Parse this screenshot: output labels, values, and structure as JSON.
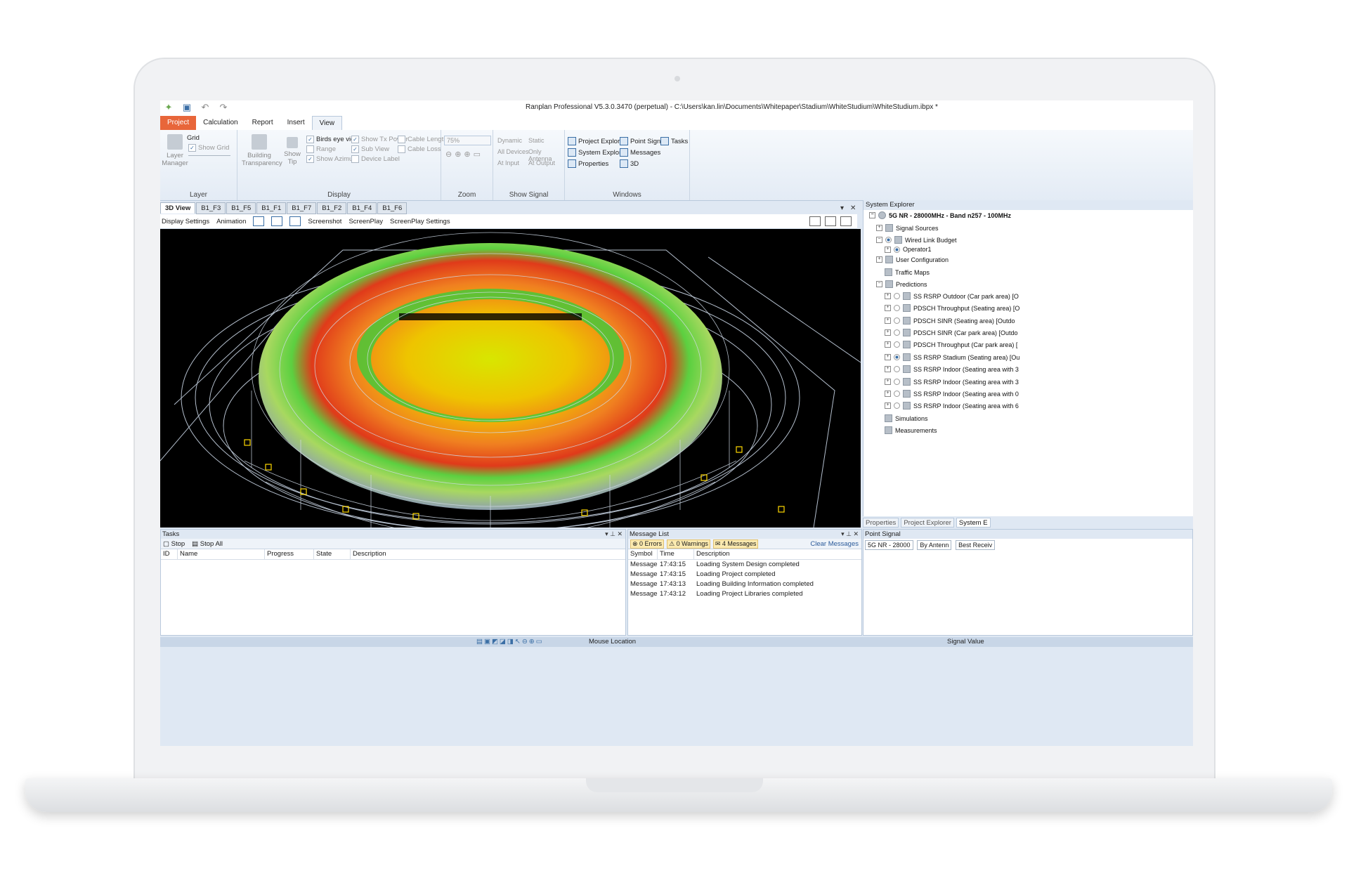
{
  "app": {
    "title": "Ranplan Professional V5.3.0.3470 (perpetual) - C:\\Users\\kan.lin\\Documents\\Whitepaper\\Stadium\\WhiteStudium\\WhiteStudium.ibpx *"
  },
  "ribbon_tabs": [
    "Project",
    "Calculation",
    "Report",
    "Insert",
    "View"
  ],
  "ribbon": {
    "layer": {
      "label": "Layer",
      "layer_manager": "Layer Manager",
      "grid": "Grid",
      "show_grid": "Show Grid"
    },
    "display": {
      "label": "Display",
      "building_transparency": "Building Transparency",
      "show_tip": "Show Tip",
      "options": [
        {
          "label": "Birds eye view",
          "checked": true
        },
        {
          "label": "Show Tx Power",
          "checked": true
        },
        {
          "label": "Cable Length",
          "checked": false
        },
        {
          "label": "Range",
          "checked": false
        },
        {
          "label": "Sub View",
          "checked": true
        },
        {
          "label": "Cable Loss",
          "checked": false
        },
        {
          "label": "Show Azimuth",
          "checked": true
        },
        {
          "label": "Device Label",
          "checked": false
        }
      ]
    },
    "zoom": {
      "label": "Zoom",
      "value": "75%"
    },
    "show_signal": {
      "label": "Show Signal",
      "items": [
        "Dynamic",
        "Static",
        "All Devices",
        "Only Antenna",
        "At Input",
        "At Output"
      ]
    },
    "windows": {
      "label": "Windows",
      "items": [
        "Project Explorer",
        "Point Signal",
        "Tasks",
        "System Explorer",
        "Messages",
        "Properties",
        "3D"
      ]
    }
  },
  "doc_tabs": [
    "3D View",
    "B1_F3",
    "B1_F5",
    "B1_F1",
    "B1_F7",
    "B1_F2",
    "B1_F4",
    "B1_F6"
  ],
  "view_toolbar": [
    "Display Settings",
    "Animation",
    "Screenshot",
    "ScreenPlay",
    "ScreenPlay Settings"
  ],
  "system_explorer": {
    "title": "System Explorer",
    "root": "5G NR - 28000MHz - Band n257 - 100MHz",
    "nodes": [
      "Signal Sources",
      "Wired Link Budget",
      "Operator1",
      "User Configuration",
      "Traffic Maps",
      "Predictions",
      "SS RSRP Outdoor (Car park area) [O",
      "PDSCH Throughput (Seating area) [O",
      "PDSCH SINR (Seating area) [Outdo",
      "PDSCH SINR (Car park area) [Outdo",
      "PDSCH Throughput (Car park area) [",
      "SS RSRP Stadium (Seating area) [Ou",
      "SS RSRP Indoor (Seating area with 3",
      "SS RSRP Indoor (Seating area with 3",
      "SS RSRP Indoor (Seating area with 0",
      "SS RSRP Indoor (Seating area with 6",
      "Simulations",
      "Measurements"
    ]
  },
  "right_tabs": [
    "Properties",
    "Project Explorer",
    "System E"
  ],
  "tasks": {
    "title": "Tasks",
    "stop": "Stop",
    "stop_all": "Stop All",
    "columns": [
      "ID",
      "Name",
      "Progress",
      "State",
      "Description"
    ]
  },
  "messages": {
    "title": "Message List",
    "errors": "0 Errors",
    "warnings": "0 Warnings",
    "count": "4 Messages",
    "clear": "Clear Messages",
    "columns": [
      "Symbol",
      "Time",
      "Description"
    ],
    "rows": [
      {
        "symbol": "Message",
        "time": "17:43:15",
        "description": "Loading System Design completed"
      },
      {
        "symbol": "Message",
        "time": "17:43:15",
        "description": "Loading Project completed"
      },
      {
        "symbol": "Message",
        "time": "17:43:13",
        "description": "Loading Building Information completed"
      },
      {
        "symbol": "Message",
        "time": "17:43:12",
        "description": "Loading Project Libraries completed"
      }
    ]
  },
  "point_signal": {
    "title": "Point Signal",
    "tech": "5G NR - 28000",
    "mode": "By Antenn",
    "result": "Best Receiv"
  },
  "status": {
    "mouse_location": "Mouse Location",
    "signal_value": "Signal Value"
  }
}
